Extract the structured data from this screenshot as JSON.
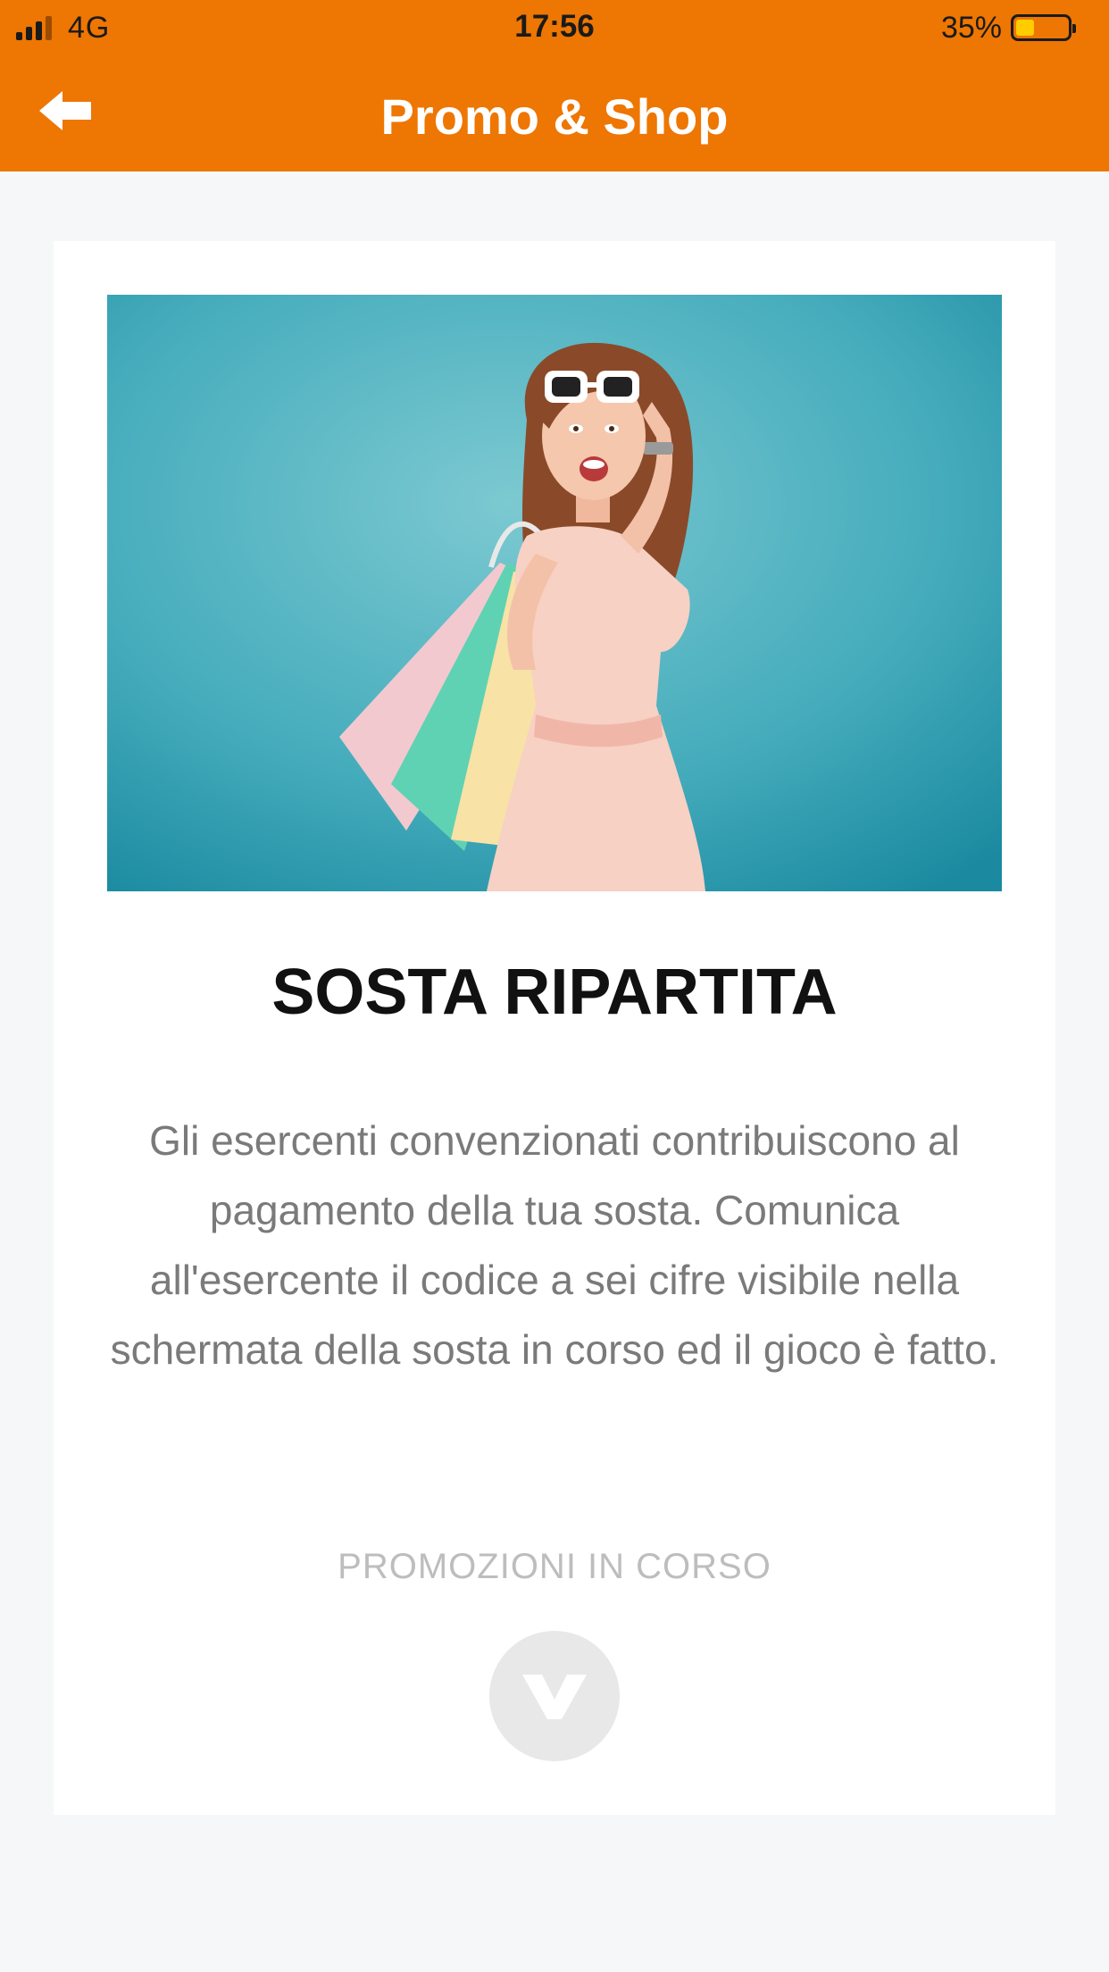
{
  "status_bar": {
    "network": "4G",
    "time": "17:56",
    "battery_percent": "35%",
    "battery_level": 0.35,
    "signal_bars_active": 3,
    "signal_bars_total": 4
  },
  "header": {
    "title": "Promo & Shop",
    "back_icon": "back-arrow-icon",
    "background_color": "#ee7602"
  },
  "promo": {
    "image_icon": "promo-shopping-woman-image",
    "title": "SOSTA RIPARTITA",
    "description": "Gli esercenti convenzionati contribuiscono al pagamento della tua sosta. Comunica all'esercente il codice a sei cifre visibile nella schermata della sosta in corso ed il gioco è fatto.",
    "link_label": "PROMOZIONI IN CORSO",
    "expand_icon": "chevron-down-icon"
  }
}
